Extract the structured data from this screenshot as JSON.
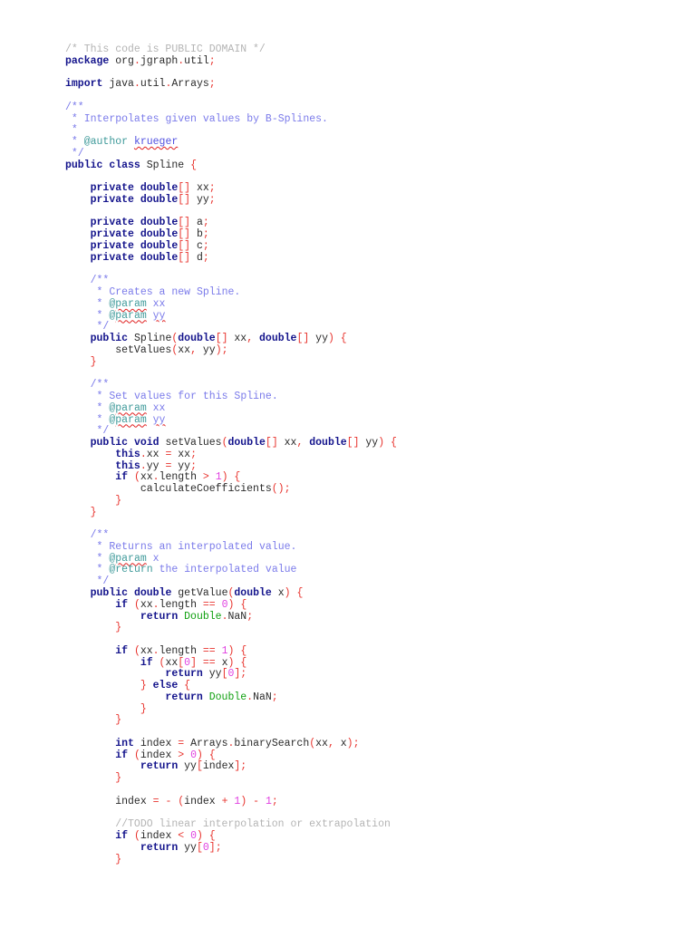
{
  "code": {
    "lines": [
      "/* This code is PUBLIC DOMAIN */",
      "package org.jgraph.util;",
      "",
      "import java.util.Arrays;",
      "",
      "/**",
      " * Interpolates given values by B-Splines.",
      " *",
      " * @author krueger",
      " */",
      "public class Spline {",
      "",
      "    private double[] xx;",
      "    private double[] yy;",
      "",
      "    private double[] a;",
      "    private double[] b;",
      "    private double[] c;",
      "    private double[] d;",
      "",
      "    /**",
      "     * Creates a new Spline.",
      "     * @param xx",
      "     * @param yy",
      "     */",
      "    public Spline(double[] xx, double[] yy) {",
      "        setValues(xx, yy);",
      "    }",
      "",
      "    /**",
      "     * Set values for this Spline.",
      "     * @param xx",
      "     * @param yy",
      "     */",
      "    public void setValues(double[] xx, double[] yy) {",
      "        this.xx = xx;",
      "        this.yy = yy;",
      "        if (xx.length > 1) {",
      "            calculateCoefficients();",
      "        }",
      "    }",
      "",
      "    /**",
      "     * Returns an interpolated value.",
      "     * @param x",
      "     * @return the interpolated value",
      "     */",
      "    public double getValue(double x) {",
      "        if (xx.length == 0) {",
      "            return Double.NaN;",
      "        }",
      "",
      "        if (xx.length == 1) {",
      "            if (xx[0] == x) {",
      "                return yy[0];",
      "            } else {",
      "                return Double.NaN;",
      "            }",
      "        }",
      "",
      "        int index = Arrays.binarySearch(xx, x);",
      "        if (index > 0) {",
      "            return yy[index];",
      "        }",
      "",
      "        index = - (index + 1) - 1;",
      "",
      "        //TODO linear interpolation or extrapolation",
      "        if (index < 0) {",
      "            return yy[0];",
      "        }"
    ]
  }
}
